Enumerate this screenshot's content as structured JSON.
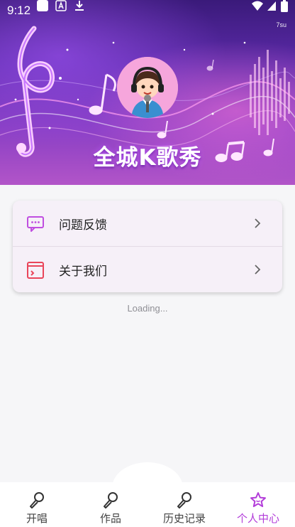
{
  "status_bar": {
    "time": "9:12",
    "tag": "7su"
  },
  "header": {
    "title": "全城K歌秀"
  },
  "menu": {
    "items": [
      {
        "label": "问题反馈",
        "icon": "chat-icon"
      },
      {
        "label": "关于我们",
        "icon": "info-card-icon"
      }
    ]
  },
  "loading_text": "Loading...",
  "bottom_nav": {
    "items": [
      {
        "label": "开唱",
        "icon": "microphone-icon"
      },
      {
        "label": "作品",
        "icon": "microphone-icon"
      },
      {
        "label": "历史记录",
        "icon": "microphone-icon"
      },
      {
        "label": "个人中心",
        "icon": "star-icon",
        "active": true
      }
    ],
    "active_color": "#b23cd9"
  },
  "colors": {
    "accent": "#b23cd9",
    "icon_red": "#e9455a",
    "icon_purple": "#c04ee0"
  }
}
